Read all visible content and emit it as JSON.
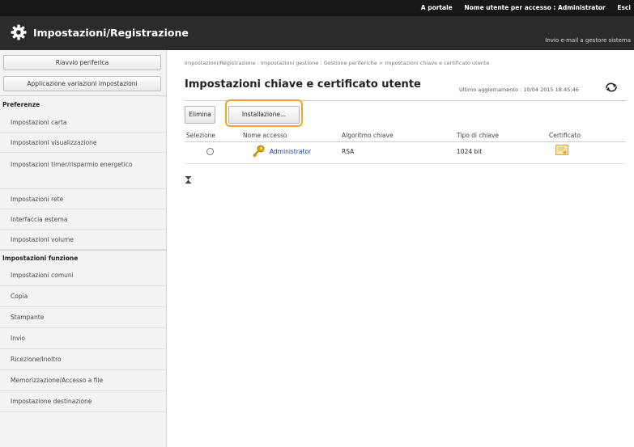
{
  "topbar": {
    "portal_link": "A portale",
    "user_label": "Nome utente per accesso : Administrator",
    "logout": "Esci"
  },
  "header": {
    "title": "Impostazioni/Registrazione",
    "mail_link": "Invio e-mail a gestore sistema",
    "icon": "gear-icon"
  },
  "sidebar": {
    "restart_button": "Riavvio periferica",
    "apply_button": "Applicazione variazioni impostazioni",
    "sections": [
      {
        "label": "Preferenze",
        "items": [
          "Impostazioni carta",
          "Impostazioni visualizzazione",
          "Impostazioni timer/risparmio energetico",
          "Impostazioni rete",
          "Interfaccia esterna",
          "Impostazioni volume"
        ]
      },
      {
        "label": "Impostazioni funzione",
        "items": [
          "Impostazioni comuni",
          "Copia",
          "Stampante",
          "Invio",
          "Ricezione/Inoltro",
          "Memorizzazione/Accesso a file",
          "Impostazione destinazione"
        ]
      }
    ]
  },
  "main": {
    "breadcrumb": "Impostazioni/Registrazione : Impostazioni gestione : Gestione periferiche > Impostazioni chiave e certificato utente",
    "title": "Impostazioni chiave e certificato utente",
    "last_updated": "Ultimo aggiornamento : 10/04 2015 18:45:46",
    "buttons": {
      "delete": "Elimina",
      "install": "Installazione..."
    },
    "table": {
      "columns": [
        "Selezione",
        "Nome accesso",
        "Algoritmo chiave",
        "Tipo di chiave",
        "Certificato"
      ],
      "rows": [
        {
          "login_name": "Administrator",
          "algorithm": "RSA",
          "key_type": "1024 bit"
        }
      ]
    }
  },
  "colors": {
    "topbar": "#171717",
    "titlebar": "#2b2b2b",
    "highlight": "#f3a22a",
    "link": "#1a3e9c"
  }
}
